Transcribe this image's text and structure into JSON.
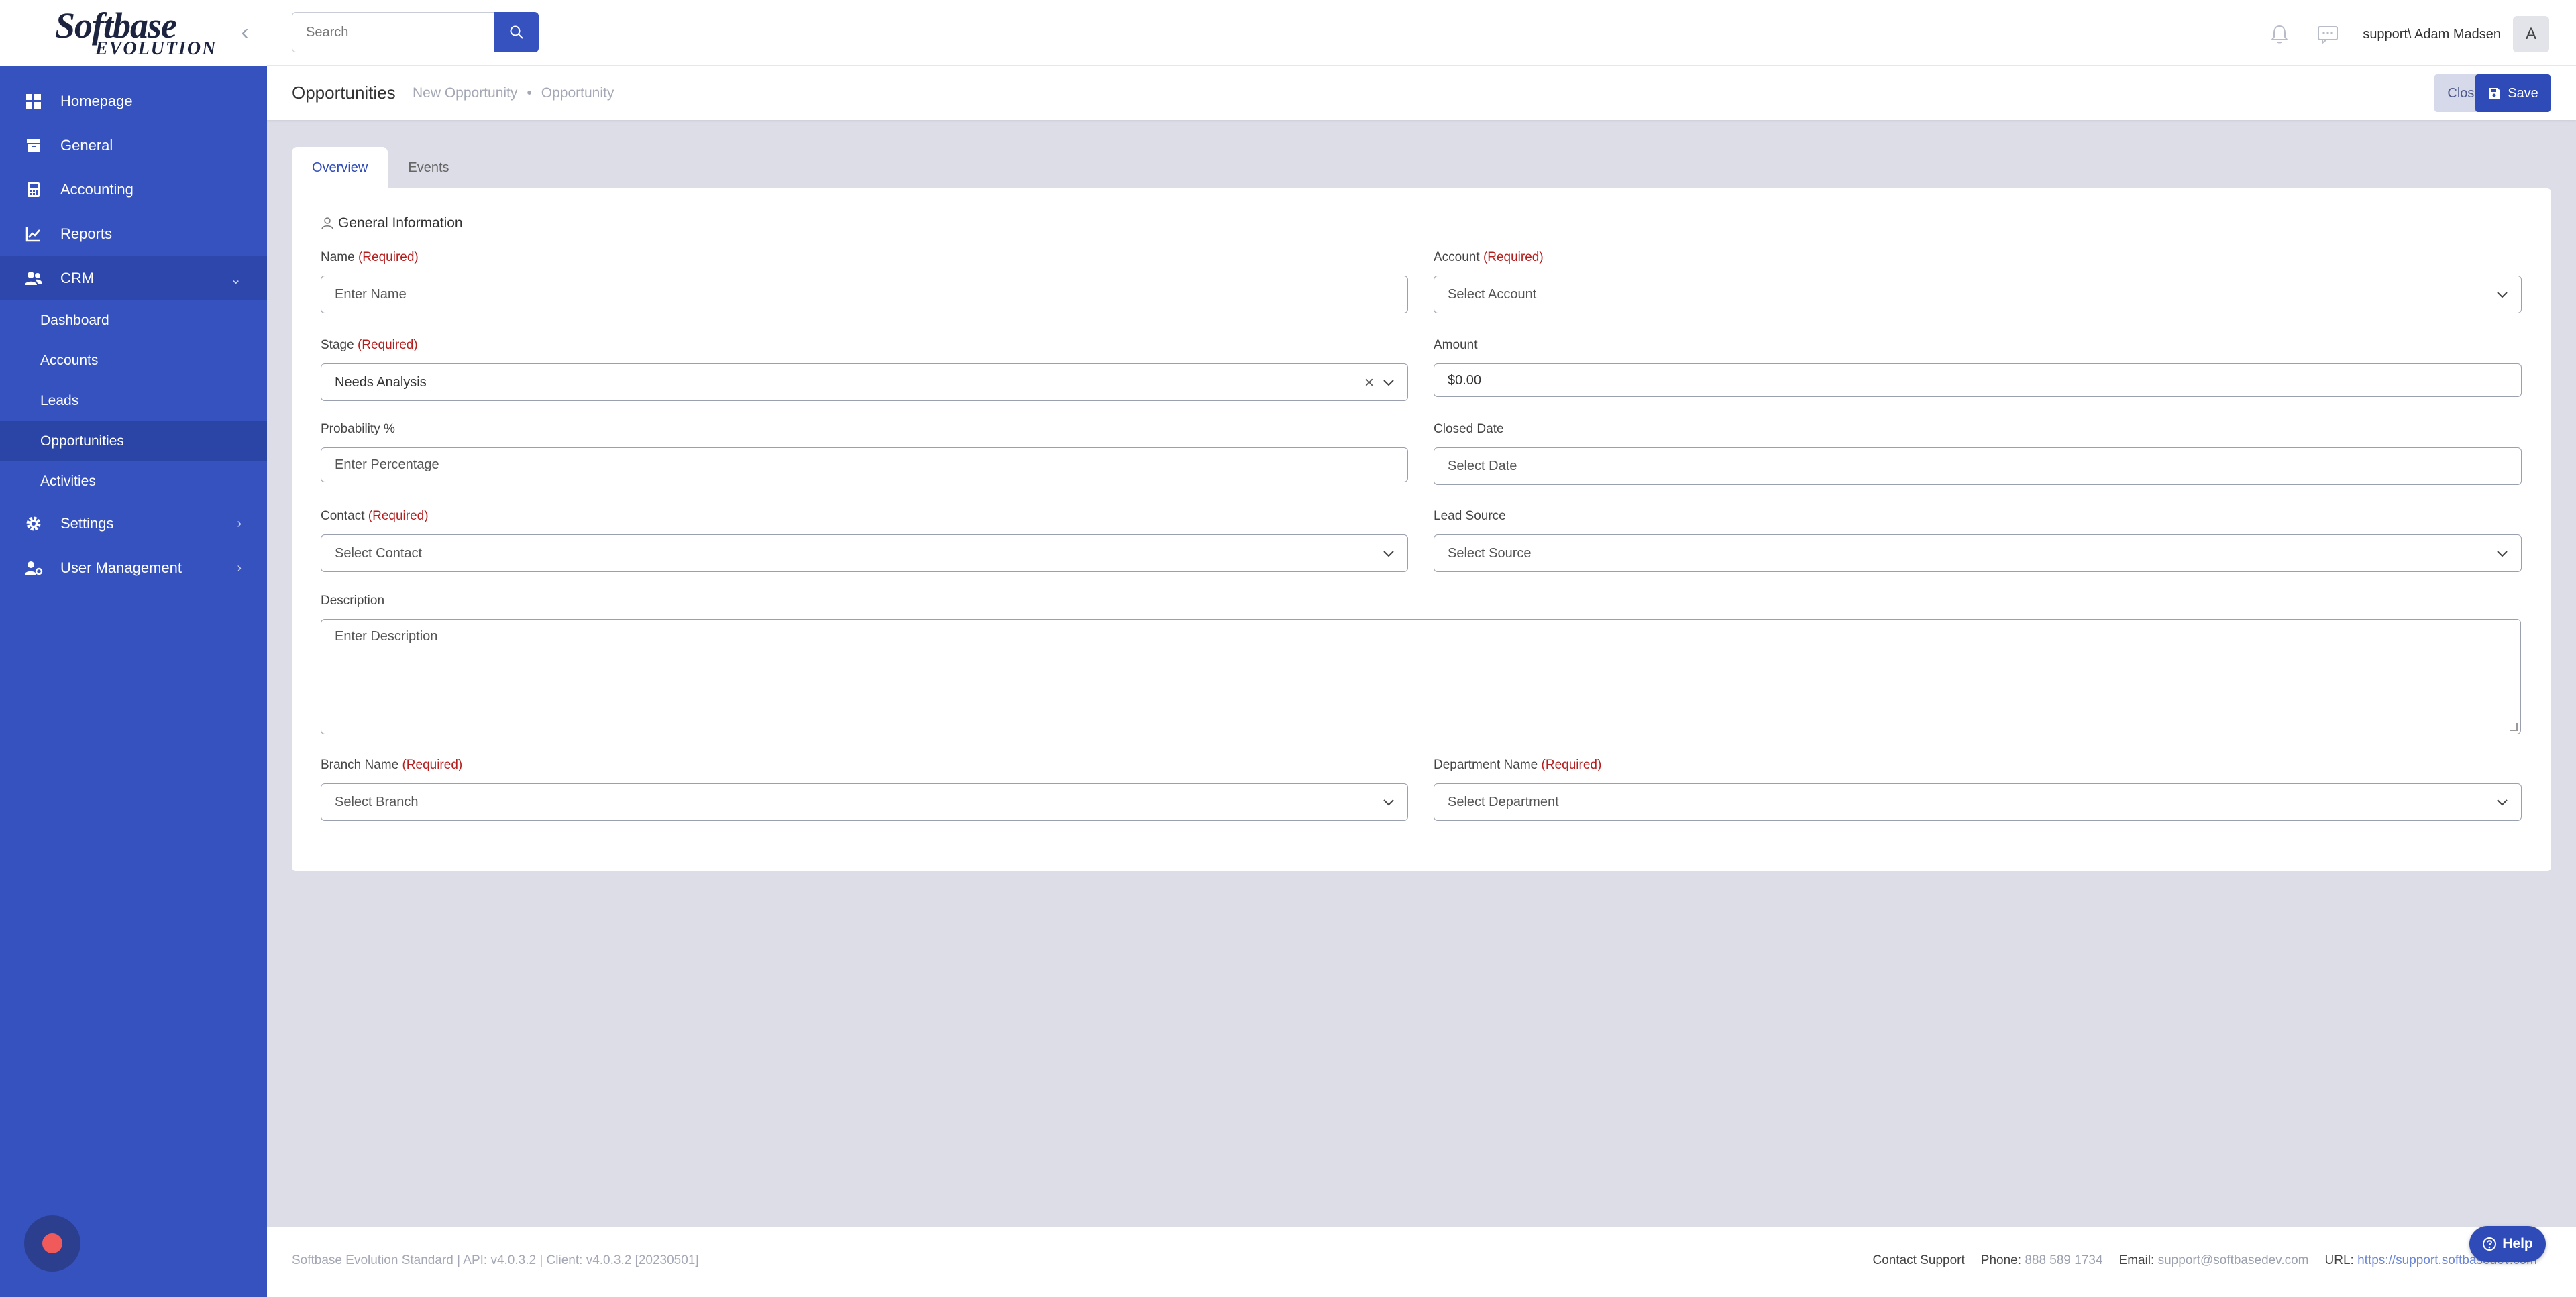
{
  "brand": {
    "logo_line1": "Softbase",
    "logo_line2": "EVOLUTION"
  },
  "sidebar": {
    "items": [
      {
        "label": "Homepage",
        "icon": "grid-icon"
      },
      {
        "label": "General",
        "icon": "archive-icon"
      },
      {
        "label": "Accounting",
        "icon": "calculator-icon"
      },
      {
        "label": "Reports",
        "icon": "chart-line-icon"
      },
      {
        "label": "CRM",
        "icon": "users-icon",
        "expanded": true
      }
    ],
    "crm_subitems": [
      "Dashboard",
      "Accounts",
      "Leads",
      "Opportunities",
      "Activities"
    ],
    "bottom_items": [
      {
        "label": "Settings",
        "icon": "gear-icon"
      },
      {
        "label": "User Management",
        "icon": "user-gear-icon"
      }
    ]
  },
  "topbar": {
    "search_placeholder": "Search",
    "user_name": "support\\ Adam Madsen",
    "avatar_initial": "A"
  },
  "header": {
    "title": "Opportunities",
    "crumb1": "New Opportunity",
    "separator": "•",
    "crumb2": "Opportunity",
    "close_label": "Close",
    "save_label": "Save"
  },
  "tabs": [
    "Overview",
    "Events"
  ],
  "form": {
    "section_title": "General Information",
    "required_tag": "(Required)",
    "name": {
      "label": "Name",
      "placeholder": "Enter Name"
    },
    "account": {
      "label": "Account",
      "placeholder": "Select Account"
    },
    "stage": {
      "label": "Stage",
      "value": "Needs Analysis"
    },
    "amount": {
      "label": "Amount",
      "value": "$0.00"
    },
    "probability": {
      "label": "Probability %",
      "placeholder": "Enter Percentage"
    },
    "closed_date": {
      "label": "Closed Date",
      "placeholder": "Select Date"
    },
    "contact": {
      "label": "Contact",
      "placeholder": "Select Contact"
    },
    "lead_source": {
      "label": "Lead Source",
      "placeholder": "Select Source"
    },
    "description": {
      "label": "Description",
      "placeholder": "Enter Description"
    },
    "branch": {
      "label": "Branch Name",
      "placeholder": "Select Branch"
    },
    "department": {
      "label": "Department Name",
      "placeholder": "Select Department"
    }
  },
  "footer": {
    "version": "Softbase Evolution Standard | API: v4.0.3.2 | Client: v4.0.3.2 [20230501]",
    "contact_support": "Contact Support",
    "phone_label": "Phone:",
    "phone": "888 589 1734",
    "email_label": "Email:",
    "email": "support@softbasedev.com",
    "url_label": "URL:",
    "url": "https://support.softbasedev.com"
  },
  "help_label": "Help",
  "colors": {
    "sidebar": "#3552bf",
    "primary": "#2f4bb8",
    "required": "#b51e1e",
    "background": "#dcdde6"
  }
}
